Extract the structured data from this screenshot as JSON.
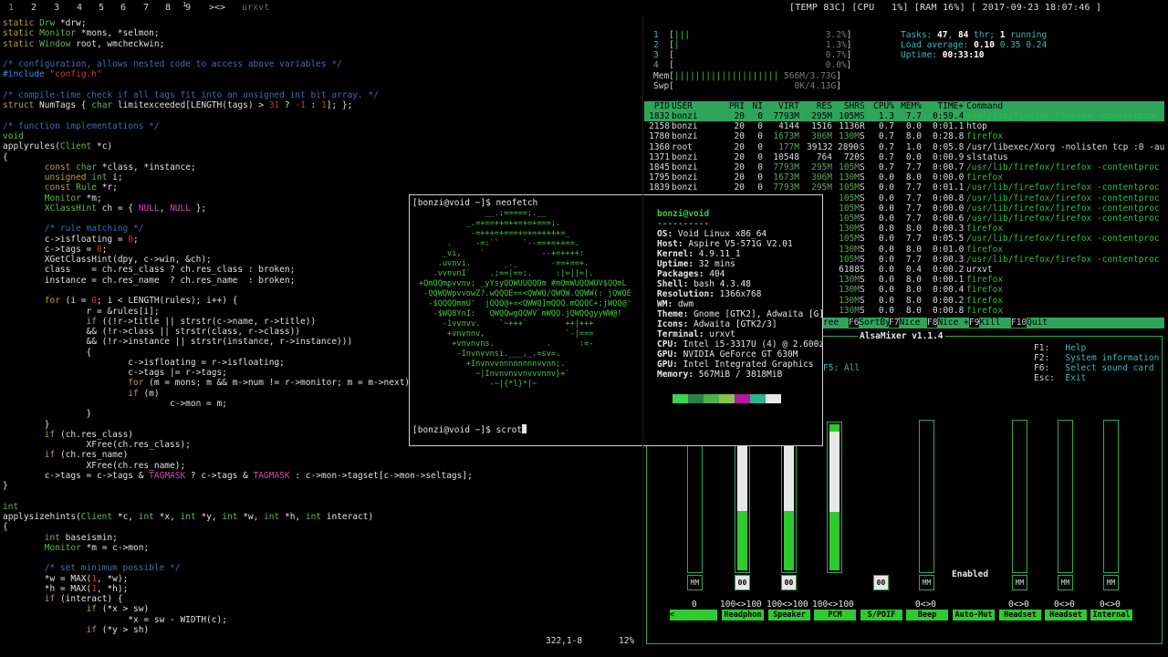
{
  "topbar": {
    "tags": [
      "1",
      "2",
      "3",
      "4",
      "5",
      "6",
      "7",
      "8",
      "9"
    ],
    "tag9_sup": "1",
    "layout": "><>",
    "window_title": "urxvt",
    "status": "[TEMP 83C] [CPU   1%] [RAM 16%] [ 2017-09-23 18:07:46 ]"
  },
  "editor": {
    "lines": [
      "static Drw *drw;",
      "static Monitor *mons, *selmon;",
      "static Window root, wmcheckwin;",
      "",
      "/* configuration, allows nested code to access above variables */",
      "#include \"config.h\"",
      "",
      "/* compile-time check if all tags fit into an unsigned int bit array. */",
      "struct NumTags { char limitexceeded[LENGTH(tags) > 31 ? -1 : 1]; };",
      "",
      "/* function implementations */",
      "void",
      "applyrules(Client *c)",
      "{",
      "        const char *class, *instance;",
      "        unsigned int i;",
      "        const Rule *r;",
      "        Monitor *m;",
      "        XClassHint ch = { NULL, NULL };",
      "",
      "        /* rule matching */",
      "        c->isfloating = 0;",
      "        c->tags = 0;",
      "        XGetClassHint(dpy, c->win, &ch);",
      "        class    = ch.res_class ? ch.res_class : broken;",
      "        instance = ch.res_name  ? ch.res_name  : broken;",
      "",
      "        for (i = 0; i < LENGTH(rules); i++) {",
      "                r = &rules[i];",
      "                if ((!r->title || strstr(c->name, r->title))",
      "                && (!r->class || strstr(class, r->class))",
      "                && (!r->instance || strstr(instance, r->instance)))",
      "                {",
      "                        c->isfloating = r->isfloating;",
      "                        c->tags |= r->tags;",
      "                        for (m = mons; m && m->num != r->monitor; m = m->next);",
      "                        if (m)",
      "                                c->mon = m;",
      "                }",
      "        }",
      "        if (ch.res_class)",
      "                XFree(ch.res_class);",
      "        if (ch.res_name)",
      "                XFree(ch.res_name);",
      "        c->tags = c->tags & TAGMASK ? c->tags & TAGMASK : c->mon->tagset[c->mon->seltags];",
      "}",
      "",
      "int",
      "applysizehints(Client *c, int *x, int *y, int *w, int *h, int interact)",
      "{",
      "        int baseismin;",
      "        Monitor *m = c->mon;",
      "",
      "        /* set minimum possible */",
      "        *w = MAX(1, *w);",
      "        *h = MAX(1, *h);",
      "        if (interact) {",
      "                if (*x > sw)",
      "                        *x = sw - WIDTH(c);",
      "                if (*y > sh)"
    ],
    "cursor_position": "322,1-8",
    "scroll_percent": "12%"
  },
  "htop": {
    "cpu_bars": [
      {
        "label": "1",
        "bars": "|||",
        "value": "3.2%"
      },
      {
        "label": "2",
        "bars": "|",
        "value": "1.3%"
      },
      {
        "label": "3",
        "bars": "",
        "value": "0.7%"
      },
      {
        "label": "4",
        "bars": "",
        "value": "0.0%"
      }
    ],
    "mem": {
      "label": "Mem",
      "bars": "||||||||||||||||||||",
      "value": "566M/3.73G"
    },
    "swp": {
      "label": "Swp",
      "bars": "",
      "value": "0K/4.13G"
    },
    "tasks_label": "Tasks: ",
    "tasks": "47",
    "thr_label": ", ",
    "thr": "84",
    "thr_suffix": " thr; ",
    "running": "1",
    "running_suffix": " running",
    "load_label": "Load average: ",
    "load1": "0.10",
    "load5": "0.35",
    "load15": "0.24",
    "uptime_label": "Uptime: ",
    "uptime": "00:33:10",
    "columns": [
      "PID",
      "USER",
      "PRI",
      "NI",
      "VIRT",
      "RES",
      "SHR",
      "S",
      "CPU%",
      "MEM%",
      "TIME+",
      "Command"
    ],
    "processes": [
      [
        "1832",
        "bonzi",
        "20",
        "0",
        "7793M",
        "295M",
        "105M",
        "S",
        "1.3",
        "7.7",
        "0:59.40",
        "/usr/lib/firefox/firefox -contentproc"
      ],
      [
        "2158",
        "bonzi",
        "20",
        "0",
        "4144",
        "1516",
        "1136",
        "R",
        "0.7",
        "0.0",
        "0:01.18",
        "htop"
      ],
      [
        "1780",
        "bonzi",
        "20",
        "0",
        "1673M",
        "306M",
        "130M",
        "S",
        "0.7",
        "8.0",
        "0:28.84",
        "firefox"
      ],
      [
        "1360",
        "root",
        "20",
        "0",
        "177M",
        "39132",
        "28904",
        "S",
        "0.7",
        "1.0",
        "0:05.88",
        "/usr/libexec/Xorg -nolisten tcp :0 -au"
      ],
      [
        "1371",
        "bonzi",
        "20",
        "0",
        "10548",
        "764",
        "720",
        "S",
        "0.7",
        "0.0",
        "0:00.91",
        "slstatus"
      ],
      [
        "1845",
        "bonzi",
        "20",
        "0",
        "7793M",
        "295M",
        "105M",
        "S",
        "0.7",
        "7.7",
        "0:00.73",
        "/usr/lib/firefox/firefox -contentproc"
      ],
      [
        "1795",
        "bonzi",
        "20",
        "0",
        "1673M",
        "306M",
        "130M",
        "S",
        "0.0",
        "8.0",
        "0:00.08",
        "firefox"
      ],
      [
        "1839",
        "bonzi",
        "20",
        "0",
        "7793M",
        "295M",
        "105M",
        "S",
        "0.0",
        "7.7",
        "0:01.19",
        "/usr/lib/firefox/firefox -contentproc"
      ],
      [
        "",
        "",
        "",
        "",
        "",
        "",
        "105M",
        "S",
        "0.0",
        "7.7",
        "0:00.89",
        "/usr/lib/firefox/firefox -contentproc"
      ],
      [
        "",
        "",
        "",
        "",
        "",
        "",
        "105M",
        "S",
        "0.0",
        "7.7",
        "0:00.01",
        "/usr/lib/firefox/firefox -contentproc"
      ],
      [
        "",
        "",
        "",
        "",
        "",
        "",
        "105M",
        "S",
        "0.0",
        "7.7",
        "0:00.61",
        "/usr/lib/firefox/firefox -contentproc"
      ],
      [
        "",
        "",
        "",
        "",
        "",
        "",
        "130M",
        "S",
        "0.0",
        "8.0",
        "0:00.34",
        "firefox"
      ],
      [
        "",
        "",
        "",
        "",
        "",
        "",
        "105M",
        "S",
        "0.0",
        "7.7",
        "0:05.58",
        "/usr/lib/firefox/firefox -contentproc"
      ],
      [
        "",
        "",
        "",
        "",
        "",
        "",
        "130M",
        "S",
        "0.0",
        "8.0",
        "0:01.05",
        "firefox"
      ],
      [
        "",
        "",
        "",
        "",
        "",
        "",
        "105M",
        "S",
        "0.0",
        "7.7",
        "0:00.38",
        "/usr/lib/firefox/firefox -contentproc"
      ],
      [
        "",
        "",
        "",
        "",
        "",
        "",
        "6188",
        "S",
        "0.0",
        "0.4",
        "0:00.22",
        "urxvt"
      ],
      [
        "",
        "",
        "",
        "",
        "",
        "",
        "130M",
        "S",
        "0.0",
        "8.0",
        "0:00.15",
        "firefox"
      ],
      [
        "",
        "",
        "",
        "",
        "",
        "",
        "130M",
        "S",
        "0.0",
        "8.0",
        "0:00.41",
        "firefox"
      ],
      [
        "",
        "",
        "",
        "",
        "",
        "",
        "130M",
        "S",
        "0.0",
        "8.0",
        "0:00.21",
        "firefox"
      ],
      [
        "",
        "",
        "",
        "",
        "",
        "",
        "130M",
        "S",
        "0.0",
        "8.0",
        "0:00.85",
        "firefox"
      ]
    ],
    "fkeys": [
      {
        "key": "",
        "label": "ree"
      },
      {
        "key": "F6",
        "label": "SortBy"
      },
      {
        "key": "F7",
        "label": "Nice -"
      },
      {
        "key": "F8",
        "label": "Nice +"
      },
      {
        "key": "F9",
        "label": "Kill"
      },
      {
        "key": "F10",
        "label": "Quit"
      }
    ]
  },
  "alsamixer": {
    "title": "AlsaMixer v1.1.4",
    "f5_all": "F5: All",
    "help": [
      {
        "key": "F1:",
        "value": "Help"
      },
      {
        "key": "F2:",
        "value": "System information"
      },
      {
        "key": "F6:",
        "value": "Select sound card"
      },
      {
        "key": "Esc:",
        "value": "Exit"
      }
    ],
    "enabled_label": "Enabled",
    "channels": [
      {
        "name": "",
        "value": "0",
        "level": 0,
        "mute": "MM",
        "mute_on": false
      },
      {
        "name": "Headphon",
        "value": "100<>100",
        "level": 1.0,
        "mute": "00",
        "mute_on": true
      },
      {
        "name": "Speaker",
        "value": "100<>100",
        "level": 1.0,
        "mute": "00",
        "mute_on": true
      },
      {
        "name": "PCM",
        "value": "100<>100",
        "level": 1.0,
        "mute": "",
        "mute_on": false
      },
      {
        "name": "S/PDIF",
        "value": "",
        "level": null,
        "mute": "00",
        "mute_on": true
      },
      {
        "name": "Beep",
        "value": "0<>0",
        "level": 0,
        "mute": "MM",
        "mute_on": false
      },
      {
        "name": "Auto-Mut",
        "value": "",
        "level": null,
        "mute": "",
        "mute_on": false
      },
      {
        "name": "Headset",
        "value": "0<>0",
        "level": 0,
        "mute": "MM",
        "mute_on": false
      },
      {
        "name": "Headset",
        "value": "0<>0",
        "level": 0,
        "mute": "MM",
        "mute_on": false
      },
      {
        "name": "Internal",
        "value": "0<>0",
        "level": 0,
        "mute": "MM",
        "mute_on": false
      }
    ]
  },
  "neofetch": {
    "prompt1": "[bonzi@void ~]$ neofetch",
    "prompt2": "[bonzi@void ~]$ scrot",
    "user_host": "bonzi@void",
    "underline": "----------",
    "logo": [
      "              __.;=====;.__",
      "          _.=+==++=++=+=+===;.",
      "           -=+++=+===+=+=+++++=_",
      "      .     -=:``     `--==+=++==.",
      "     _vi,    `            --+=++++:",
      "    .uvnvi.       _._       -==+==+.",
      "   .vvnvnI`    .;==|==;.     :|=||=|.",
      "+QmQQmpvvnv; _yYsyQQWUUQQQm #mQmWUQQWUV$QQmL",
      " -QQWQWpvvowZ?.wQQQE==<QWWQ/QWQW.QQWW(: jQWQE",
      "  -$QQQQmmU'  jQQQ@+=<QWWQ]mQQQ.mQQQC+;jWQQ@'",
      "   -$WQ8YnI:   QWQQwgQQWV`mWQQ.jQWQQgyyWW@!",
      "     -1vvnvv.    `~+++`        ++|+++",
      "      +vnvnnv,                 `-|===",
      "       +vnvnvns.           .      :=-",
      "        -Invnvvnsi.___,_.=sv=.",
      "          +Invnvvnnnnnnnnvvnn;.",
      "            ~|Invnvnvvnvvvnnv}+`",
      "               -~|{*l}*|~"
    ],
    "info": [
      {
        "key": "OS:",
        "value": "Void Linux x86_64"
      },
      {
        "key": "Host:",
        "value": "Aspire V5-571G V2.01"
      },
      {
        "key": "Kernel:",
        "value": "4.9.11_1"
      },
      {
        "key": "Uptime:",
        "value": "32 mins"
      },
      {
        "key": "Packages:",
        "value": "404"
      },
      {
        "key": "Shell:",
        "value": "bash 4.3.48"
      },
      {
        "key": "Resolution:",
        "value": "1366x768"
      },
      {
        "key": "WM:",
        "value": "dwm"
      },
      {
        "key": "Theme:",
        "value": "Gnome [GTK2], Adwaita [G]"
      },
      {
        "key": "Icons:",
        "value": "Adwaita [GTK2/3]"
      },
      {
        "key": "Terminal:",
        "value": "urxvt"
      },
      {
        "key": "CPU:",
        "value": "Intel i5-3317U (4) @ 2.600z"
      },
      {
        "key": "GPU:",
        "value": "NVIDIA GeForce GT 630M"
      },
      {
        "key": "GPU:",
        "value": "Intel Integrated Graphics"
      },
      {
        "key": "Memory:",
        "value": "567MiB / 3818MiB"
      }
    ],
    "swatches": [
      "#39d353",
      "#2e7d4a",
      "#4caf50",
      "#8bc34a",
      "#b5179e",
      "#2fb48c",
      "#e8e8e8"
    ]
  }
}
